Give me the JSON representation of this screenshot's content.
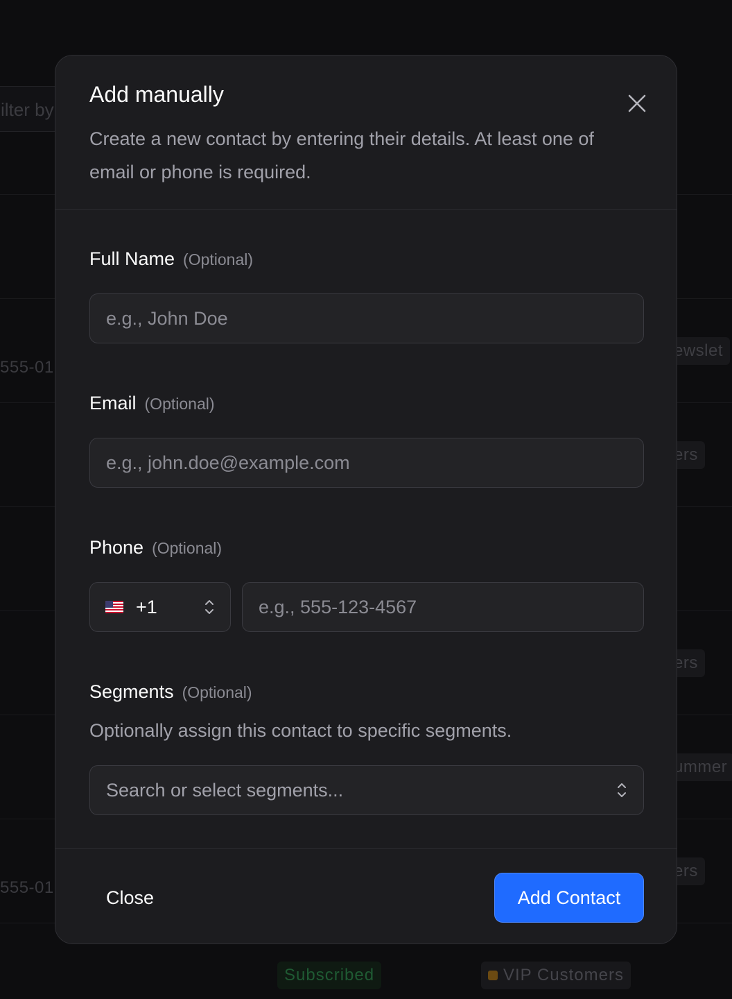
{
  "background": {
    "filter_placeholder_fragment": "ilter by",
    "phone_fragment_1": "555-01",
    "phone_fragment_2": "555-01",
    "badge_fragments": [
      "ewslet",
      "ers",
      "ers",
      "ummer",
      "ers"
    ],
    "status_badge": "Subscribed",
    "segment_badge": "VIP Customers",
    "colors": {
      "subscribed": "#1f5a33",
      "vip_dot": "#6b4a12"
    }
  },
  "modal": {
    "title": "Add manually",
    "description": "Create a new contact by entering their details. At least one of email or phone is required.",
    "close_icon": "close-icon",
    "fields": {
      "full_name": {
        "label": "Full Name",
        "optional": "(Optional)",
        "value": "",
        "placeholder": "e.g., John Doe"
      },
      "email": {
        "label": "Email",
        "optional": "(Optional)",
        "value": "",
        "placeholder": "e.g., john.doe@example.com"
      },
      "phone": {
        "label": "Phone",
        "optional": "(Optional)",
        "country_flag": "us-flag-icon",
        "dial_code": "+1",
        "value": "",
        "placeholder": "e.g., 555-123-4567"
      },
      "segments": {
        "label": "Segments",
        "optional": "(Optional)",
        "description": "Optionally assign this contact to specific segments.",
        "placeholder": "Search or select segments..."
      }
    },
    "footer": {
      "close_label": "Close",
      "submit_label": "Add Contact"
    },
    "colors": {
      "primary": "#1f6bff",
      "surface": "#1c1c1f",
      "input_bg": "#232326"
    }
  }
}
